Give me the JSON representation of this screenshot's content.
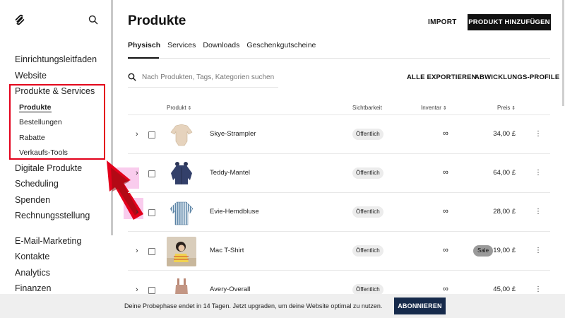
{
  "sidebar": {
    "logo_icon": "squarespace-logo-icon",
    "search_icon": "search-icon",
    "items": [
      {
        "label": "Einrichtungsleitfaden"
      },
      {
        "label": "Website"
      },
      {
        "label": "Produkte & Services"
      },
      {
        "label": "Digitale Produkte"
      },
      {
        "label": "Scheduling"
      },
      {
        "label": "Spenden"
      },
      {
        "label": "Rechnungsstellung"
      },
      {
        "label": "E-Mail-Marketing"
      },
      {
        "label": "Kontakte"
      },
      {
        "label": "Analytics"
      },
      {
        "label": "Finanzen"
      }
    ],
    "subitems": [
      {
        "label": "Produkte",
        "active": true
      },
      {
        "label": "Bestellungen"
      },
      {
        "label": "Rabatte"
      },
      {
        "label": "Verkaufs-Tools"
      }
    ]
  },
  "header": {
    "title": "Produkte",
    "import_label": "IMPORT",
    "add_label": "PRODUKT HINZUFÜGEN"
  },
  "tabs": [
    {
      "label": "Physisch",
      "active": true
    },
    {
      "label": "Services"
    },
    {
      "label": "Downloads"
    },
    {
      "label": "Geschenkgutscheine"
    }
  ],
  "search": {
    "placeholder": "Nach Produkten, Tags, Kategorien suchen"
  },
  "actions": {
    "export_label": "ALLE EXPORTIEREN",
    "profiles_label": "ABWICKLUNGS-PROFILE"
  },
  "table": {
    "headers": {
      "product": "Produkt",
      "visibility": "Sichtbarkeit",
      "inventory": "Inventar",
      "price": "Preis"
    },
    "rows": [
      {
        "name": "Skye-Strampler",
        "visibility": "Öffentlich",
        "inventory": "∞",
        "price": "34,00 £",
        "sale": "",
        "thumb_icon": "romper-thumbnail"
      },
      {
        "name": "Teddy-Mantel",
        "visibility": "Öffentlich",
        "inventory": "∞",
        "price": "64,00 £",
        "sale": "",
        "thumb_icon": "coat-thumbnail"
      },
      {
        "name": "Evie-Hemdbluse",
        "visibility": "Öffentlich",
        "inventory": "∞",
        "price": "28,00 £",
        "sale": "",
        "thumb_icon": "shirt-thumbnail"
      },
      {
        "name": "Mac T-Shirt",
        "visibility": "Öffentlich",
        "inventory": "∞",
        "price": "19,00 £",
        "sale": "Sale",
        "thumb_icon": "child-photo-thumbnail"
      },
      {
        "name": "Avery-Overall",
        "visibility": "Öffentlich",
        "inventory": "∞",
        "price": "45,00 £",
        "sale": "",
        "thumb_icon": "overall-thumbnail"
      }
    ]
  },
  "banner": {
    "text": "Deine Probephase endet in 14 Tagen. Jetzt upgraden, um deine Website optimal zu nutzen.",
    "button_label": "ABONNIEREN"
  },
  "colors": {
    "accent": "#111111",
    "highlight": "#e3001b",
    "banner_button": "#162a4b"
  }
}
